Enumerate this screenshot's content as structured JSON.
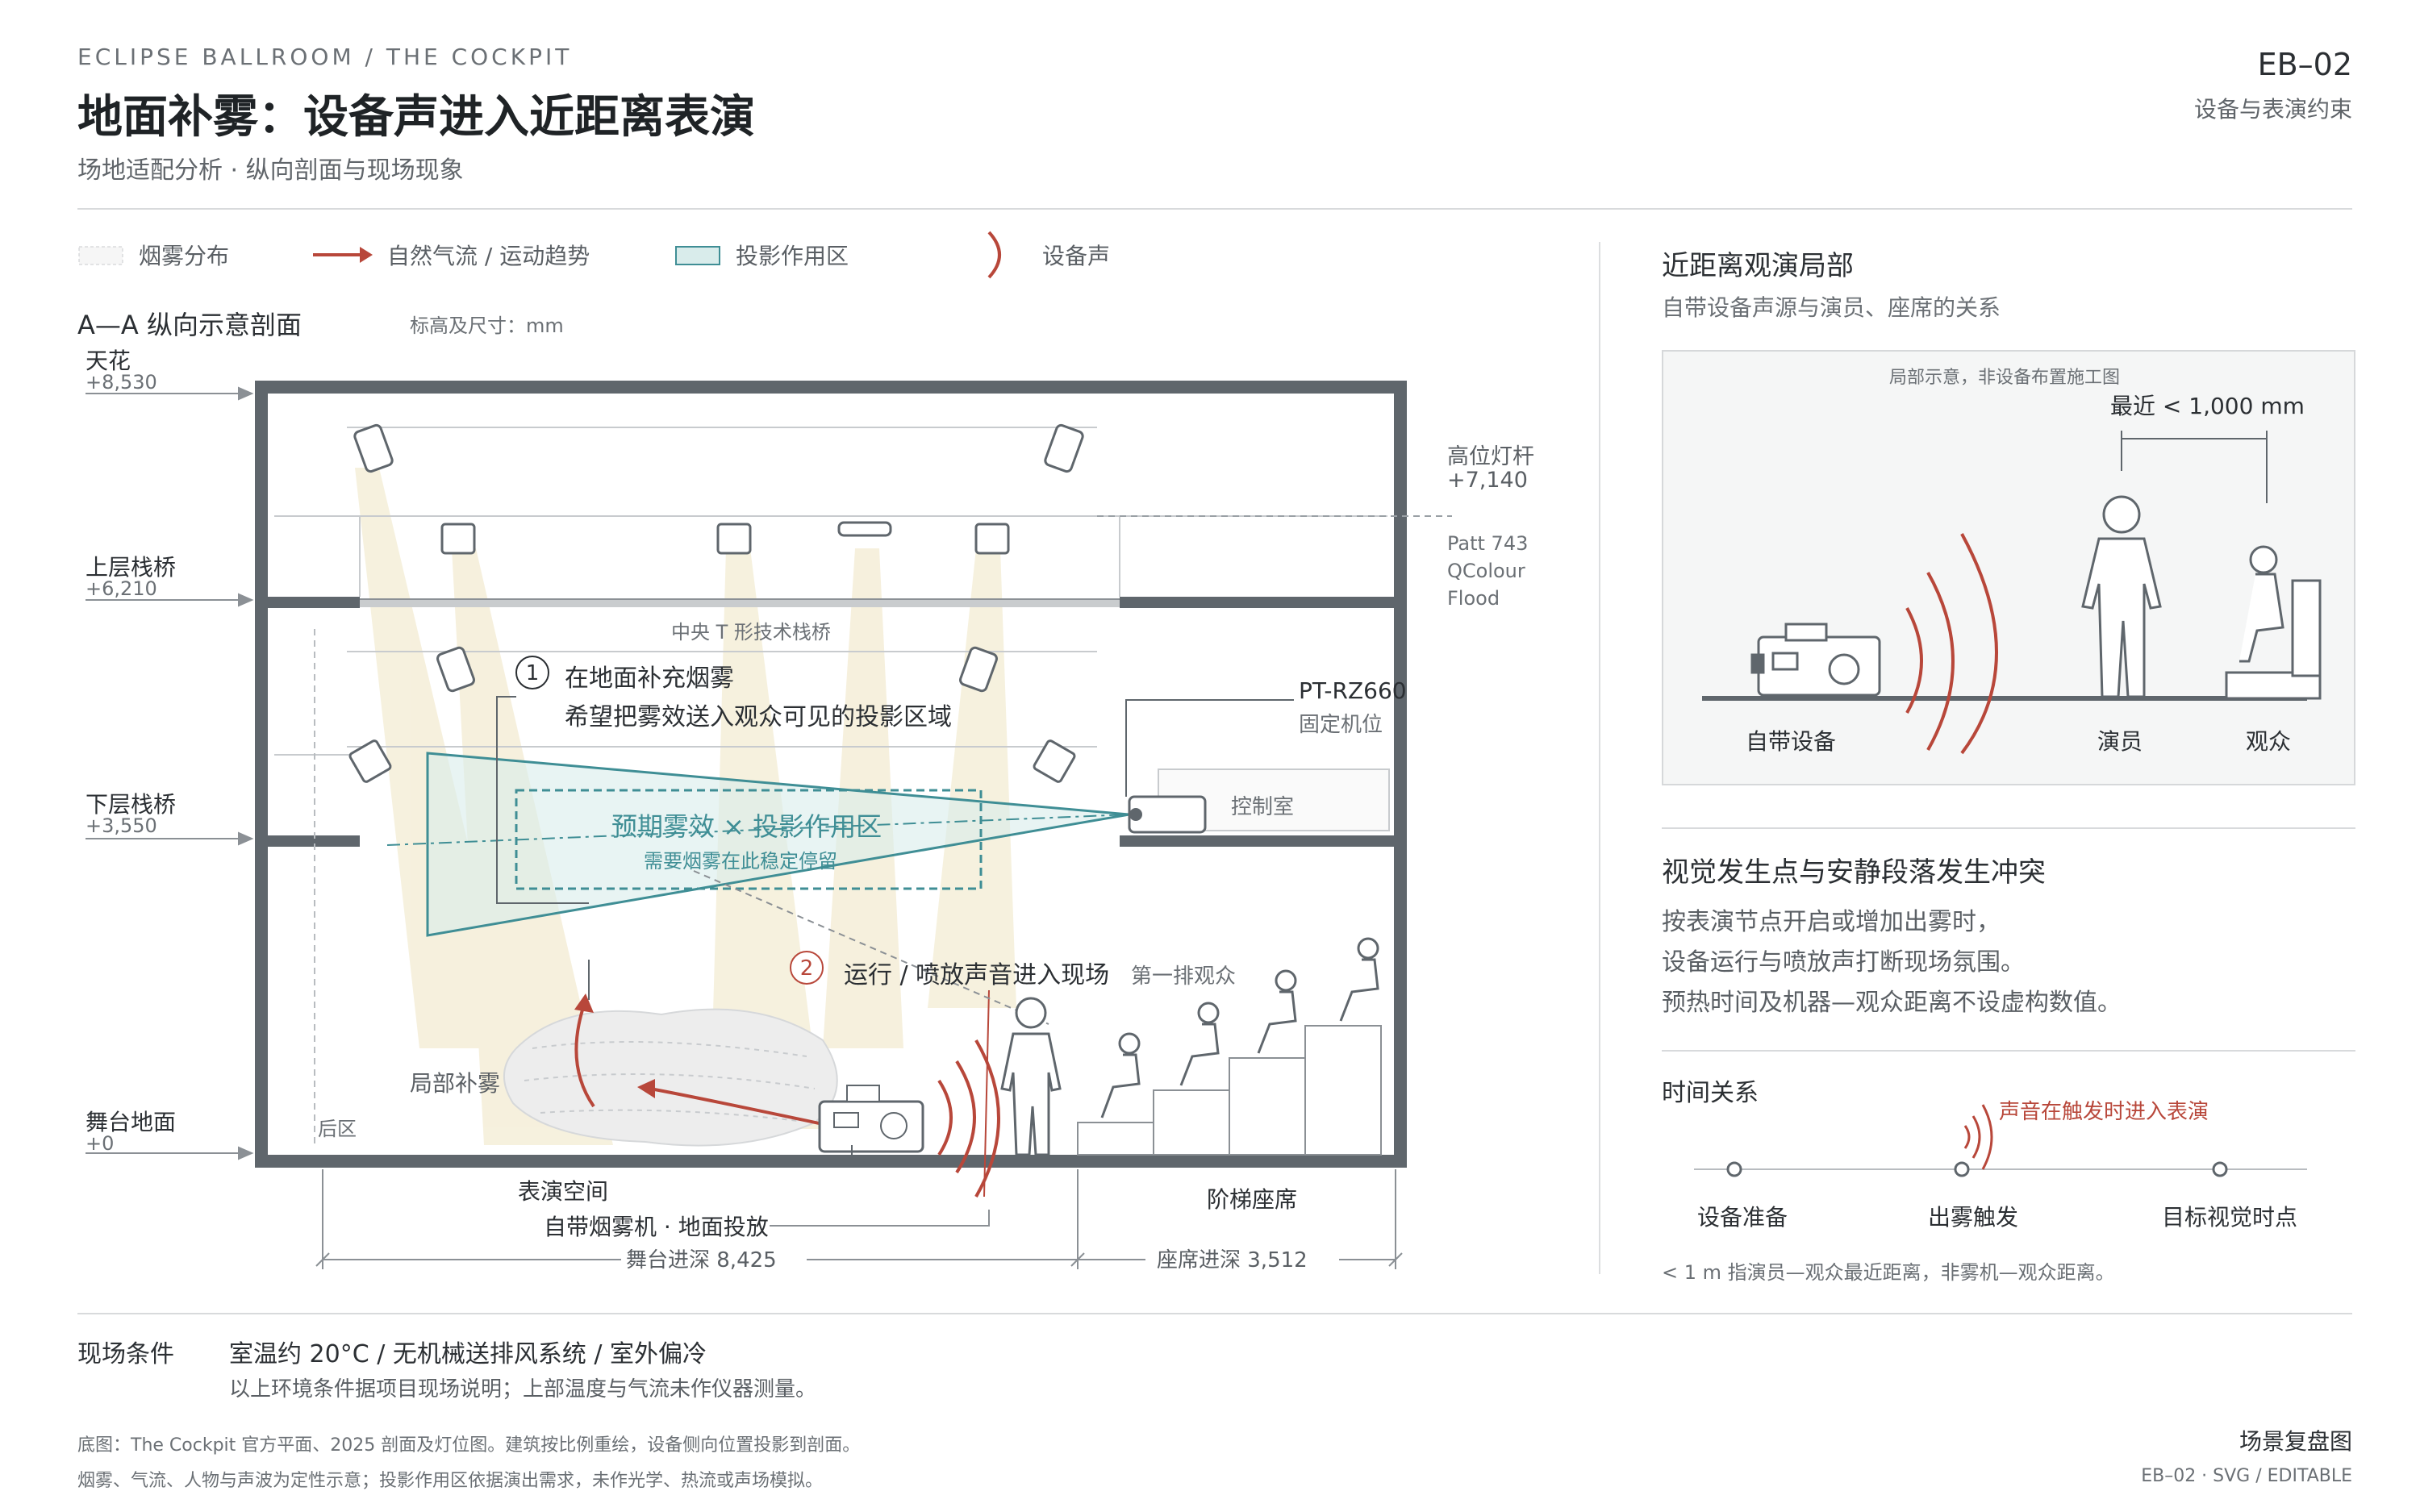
{
  "header": {
    "kicker": "ECLIPSE BALLROOM / THE COCKPIT",
    "title": "地面补雾：设备声进入近距离表演",
    "subtitle": "场地适配分析 · 纵向剖面与现场现象",
    "code": "EB–02",
    "code_sub": "设备与表演约束"
  },
  "legend": {
    "fog": "烟雾分布",
    "airflow": "自然气流 / 运动趋势",
    "projection": "投影作用区",
    "sound": "设备声"
  },
  "section": {
    "title": "A—A 纵向示意剖面",
    "units": "标高及尺寸：mm",
    "levels": [
      {
        "name": "天花",
        "value": "+8,530"
      },
      {
        "name": "上层栈桥",
        "value": "+6,210"
      },
      {
        "name": "下层栈桥",
        "value": "+3,550"
      },
      {
        "name": "舞台地面",
        "value": "+0"
      }
    ],
    "high_bar": {
      "name": "高位灯杆",
      "value": "+7,140"
    },
    "fixture": [
      "Patt 743",
      "QColour",
      "Flood"
    ],
    "central_bridge": "中央 T 形技术栈桥",
    "callout1_title": "在地面补充烟雾",
    "callout1_desc": "希望把雾效送入观众可见的投影区域",
    "projector_model": "PT-RZ660",
    "projector_note": "固定机位",
    "control_room": "控制室",
    "zone_title": "预期雾效 × 投影作用区",
    "zone_sub": "需要烟雾在此稳定停留",
    "callout2": "运行 / 喷放声音进入现场",
    "front_row": "第一排观众",
    "local_fog": "局部补雾",
    "backstage": "后区",
    "perf_space": "表演空间",
    "machine": "自带烟雾机 · 地面投放",
    "seating": "阶梯座席",
    "stage_depth": "舞台进深 8,425",
    "seat_depth": "座席进深 3,512",
    "num1": "1",
    "num2": "2"
  },
  "panel": {
    "title": "近距离观演局部",
    "subtitle": "自带设备声源与演员、座席的关系",
    "caption": "局部示意，非设备布置施工图",
    "distance": "最近 < 1,000 mm",
    "device": "自带设备",
    "actor": "演员",
    "audience": "观众"
  },
  "conflict": {
    "title": "视觉发生点与安静段落发生冲突",
    "lines": [
      "按表演节点开启或增加出雾时，",
      "设备运行与喷放声打断现场氛围。",
      "预热时间及机器—观众距离不设虚构数值。"
    ]
  },
  "timeline": {
    "title": "时间关系",
    "alert": "声音在触发时进入表演",
    "steps": [
      "设备准备",
      "出雾触发",
      "目标视觉时点"
    ],
    "note": "< 1 m 指演员—观众最近距离，非雾机—观众距离。"
  },
  "conditions": {
    "label": "现场条件",
    "value": "室温约 20°C / 无机械送排风系统 / 室外偏冷",
    "note": "以上环境条件据项目现场说明；上部温度与气流未作仪器测量。"
  },
  "footer": {
    "line1": "底图：The Cockpit 官方平面、2025 剖面及灯位图。建筑按比例重绘，设备侧向位置投影到剖面。",
    "line2": "烟雾、气流、人物与声波为定性示意；投影作用区依据演出需求，未作光学、热流或声场模拟。",
    "right_title": "场景复盘图",
    "right_sub": "EB–02 · SVG / EDITABLE"
  },
  "colors": {
    "wall": "#5f666c",
    "accent_red": "#b8473a",
    "teal": "#3f8e95",
    "teal_fill": "#d9eceb",
    "beam": "#f3ead2"
  }
}
